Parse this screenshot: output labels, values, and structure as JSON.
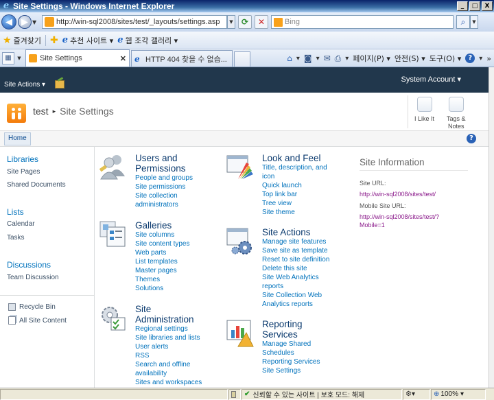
{
  "window": {
    "title": "Site Settings - Windows Internet Explorer",
    "controls": {
      "minimize": "_",
      "maximize": "□",
      "close": "X"
    }
  },
  "address_bar": {
    "url": "http://win-sql2008/sites/test/_layouts/settings.asp"
  },
  "search_bar": {
    "placeholder": "Bing"
  },
  "favorites_bar": {
    "favorites_label": "즐겨찾기",
    "items": [
      "추천 사이트 ▾",
      "웹 조각 갤러리 ▾"
    ]
  },
  "tabs": [
    {
      "label": "Site Settings",
      "active": true
    },
    {
      "label": "HTTP 404 찾을 수 없습...",
      "active": false
    }
  ],
  "command_bar": {
    "page": "페이지(P) ▾",
    "safety": "안전(S) ▾",
    "tools": "도구(O) ▾",
    "more": "»"
  },
  "ribbon": {
    "site_actions": "Site Actions ▾",
    "user": "System Account ▾"
  },
  "title_area": {
    "site_name": "test",
    "separator": "▸",
    "page_name": "Site Settings",
    "i_like_it": "I Like It",
    "tags_notes_line1": "Tags &",
    "tags_notes_line2": "Notes"
  },
  "top_nav": {
    "home": "Home",
    "help": "?"
  },
  "quick_launch": {
    "libraries_head": "Libraries",
    "libraries": [
      "Site Pages",
      "Shared Documents"
    ],
    "lists_head": "Lists",
    "lists": [
      "Calendar",
      "Tasks"
    ],
    "discussions_head": "Discussions",
    "discussions": [
      "Team Discussion"
    ],
    "recycle_bin": "Recycle Bin",
    "all_site_content": "All Site Content"
  },
  "sections": {
    "users": {
      "title_1": "Users and",
      "title_2": "Permissions",
      "links": [
        "People and groups",
        "Site permissions",
        "Site collection",
        "administrators"
      ]
    },
    "galleries": {
      "title_1": "Galleries",
      "links": [
        "Site columns",
        "Site content types",
        "Web parts",
        "List templates",
        "Master pages",
        "Themes",
        "Solutions"
      ]
    },
    "site_admin": {
      "title_1": "Site",
      "title_2": "Administration",
      "links": [
        "Regional settings",
        "Site libraries and lists",
        "User alerts",
        "RSS",
        "Search and offline",
        "availability",
        "Sites and workspaces"
      ]
    },
    "look_feel": {
      "title_1": "Look and Feel",
      "links": [
        "Title, description, and",
        "icon",
        "Quick launch",
        "Top link bar",
        "Tree view",
        "Site theme"
      ]
    },
    "site_actions": {
      "title_1": "Site Actions",
      "links": [
        "Manage site features",
        "Save site as template",
        "Reset to site definition",
        "Delete this site",
        "Site Web Analytics",
        "reports",
        "Site Collection Web",
        "Analytics reports"
      ]
    },
    "reporting": {
      "title_1": "Reporting",
      "title_2": "Services",
      "links": [
        "Manage Shared",
        "Schedules",
        "Reporting Services",
        "Site Settings"
      ]
    }
  },
  "site_info": {
    "title": "Site Information",
    "url_label": "Site URL:",
    "url_value": "http://win-sql2008/sites/test/",
    "mobile_label": "Mobile Site URL:",
    "mobile_value": "http://win-sql2008/sites/test/?Mobile=1"
  },
  "status_bar": {
    "zone": "신뢰할 수 있는 사이트 | 보호 모드: 해제",
    "zoom": "100%"
  }
}
